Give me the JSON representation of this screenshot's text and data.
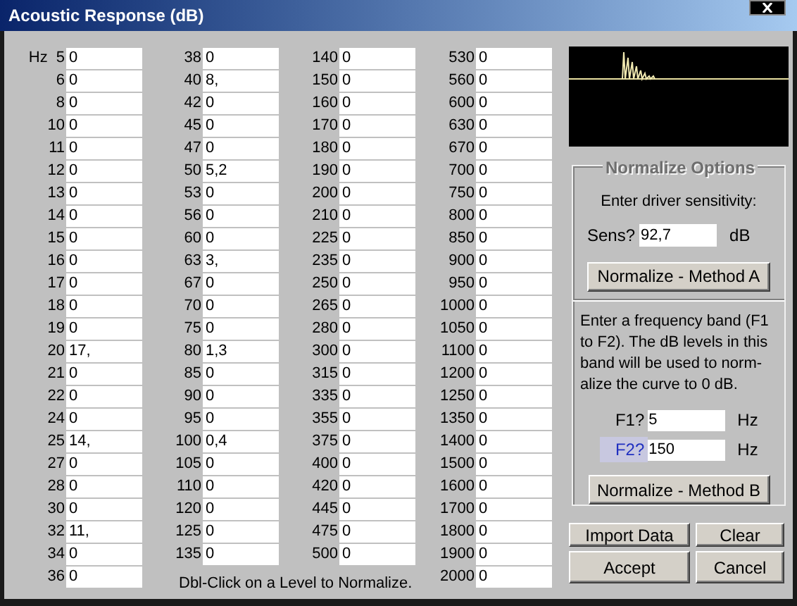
{
  "window": {
    "title": "Acoustic Response (dB)"
  },
  "unit_label": "Hz",
  "columns": [
    [
      {
        "hz": "5",
        "value": "0"
      },
      {
        "hz": "6",
        "value": "0"
      },
      {
        "hz": "8",
        "value": "0"
      },
      {
        "hz": "10",
        "value": "0"
      },
      {
        "hz": "11",
        "value": "0"
      },
      {
        "hz": "12",
        "value": "0"
      },
      {
        "hz": "13",
        "value": "0"
      },
      {
        "hz": "14",
        "value": "0"
      },
      {
        "hz": "15",
        "value": "0"
      },
      {
        "hz": "16",
        "value": "0"
      },
      {
        "hz": "17",
        "value": "0"
      },
      {
        "hz": "18",
        "value": "0"
      },
      {
        "hz": "19",
        "value": "0"
      },
      {
        "hz": "20",
        "value": "17,"
      },
      {
        "hz": "21",
        "value": "0"
      },
      {
        "hz": "22",
        "value": "0"
      },
      {
        "hz": "24",
        "value": "0"
      },
      {
        "hz": "25",
        "value": "14,"
      },
      {
        "hz": "27",
        "value": "0"
      },
      {
        "hz": "28",
        "value": "0"
      },
      {
        "hz": "30",
        "value": "0"
      },
      {
        "hz": "32",
        "value": "11,"
      },
      {
        "hz": "34",
        "value": "0"
      },
      {
        "hz": "36",
        "value": "0"
      }
    ],
    [
      {
        "hz": "38",
        "value": "0"
      },
      {
        "hz": "40",
        "value": "8,"
      },
      {
        "hz": "42",
        "value": "0"
      },
      {
        "hz": "45",
        "value": "0"
      },
      {
        "hz": "47",
        "value": "0"
      },
      {
        "hz": "50",
        "value": "5,2"
      },
      {
        "hz": "53",
        "value": "0"
      },
      {
        "hz": "56",
        "value": "0"
      },
      {
        "hz": "60",
        "value": "0"
      },
      {
        "hz": "63",
        "value": "3,"
      },
      {
        "hz": "67",
        "value": "0"
      },
      {
        "hz": "70",
        "value": "0"
      },
      {
        "hz": "75",
        "value": "0"
      },
      {
        "hz": "80",
        "value": "1,3"
      },
      {
        "hz": "85",
        "value": "0"
      },
      {
        "hz": "90",
        "value": "0"
      },
      {
        "hz": "95",
        "value": "0"
      },
      {
        "hz": "100",
        "value": "0,4"
      },
      {
        "hz": "105",
        "value": "0"
      },
      {
        "hz": "110",
        "value": "0"
      },
      {
        "hz": "120",
        "value": "0"
      },
      {
        "hz": "125",
        "value": "0"
      },
      {
        "hz": "135",
        "value": "0"
      }
    ],
    [
      {
        "hz": "140",
        "value": "0"
      },
      {
        "hz": "150",
        "value": "0"
      },
      {
        "hz": "160",
        "value": "0"
      },
      {
        "hz": "170",
        "value": "0"
      },
      {
        "hz": "180",
        "value": "0"
      },
      {
        "hz": "190",
        "value": "0"
      },
      {
        "hz": "200",
        "value": "0"
      },
      {
        "hz": "210",
        "value": "0"
      },
      {
        "hz": "225",
        "value": "0"
      },
      {
        "hz": "235",
        "value": "0"
      },
      {
        "hz": "250",
        "value": "0"
      },
      {
        "hz": "265",
        "value": "0"
      },
      {
        "hz": "280",
        "value": "0"
      },
      {
        "hz": "300",
        "value": "0"
      },
      {
        "hz": "315",
        "value": "0"
      },
      {
        "hz": "335",
        "value": "0"
      },
      {
        "hz": "355",
        "value": "0"
      },
      {
        "hz": "375",
        "value": "0"
      },
      {
        "hz": "400",
        "value": "0"
      },
      {
        "hz": "420",
        "value": "0"
      },
      {
        "hz": "445",
        "value": "0"
      },
      {
        "hz": "475",
        "value": "0"
      },
      {
        "hz": "500",
        "value": "0"
      }
    ],
    [
      {
        "hz": "530",
        "value": "0"
      },
      {
        "hz": "560",
        "value": "0"
      },
      {
        "hz": "600",
        "value": "0"
      },
      {
        "hz": "630",
        "value": "0"
      },
      {
        "hz": "670",
        "value": "0"
      },
      {
        "hz": "700",
        "value": "0"
      },
      {
        "hz": "750",
        "value": "0"
      },
      {
        "hz": "800",
        "value": "0"
      },
      {
        "hz": "850",
        "value": "0"
      },
      {
        "hz": "900",
        "value": "0"
      },
      {
        "hz": "950",
        "value": "0"
      },
      {
        "hz": "1000",
        "value": "0"
      },
      {
        "hz": "1050",
        "value": "0"
      },
      {
        "hz": "1100",
        "value": "0"
      },
      {
        "hz": "1200",
        "value": "0"
      },
      {
        "hz": "1250",
        "value": "0"
      },
      {
        "hz": "1350",
        "value": "0"
      },
      {
        "hz": "1400",
        "value": "0"
      },
      {
        "hz": "1500",
        "value": "0"
      },
      {
        "hz": "1600",
        "value": "0"
      },
      {
        "hz": "1700",
        "value": "0"
      },
      {
        "hz": "1800",
        "value": "0"
      },
      {
        "hz": "1900",
        "value": "0"
      },
      {
        "hz": "2000",
        "value": "0"
      }
    ]
  ],
  "hint": "Dbl-Click on a Level to Normalize.",
  "normalize_options": {
    "title": "Normalize Options",
    "method_a": {
      "prompt": "Enter driver sensitivity:",
      "field": {
        "label": "Sens?",
        "value": "92,7",
        "unit": "dB"
      },
      "button": "Normalize - Method A"
    },
    "method_b": {
      "prompt": "Enter a frequency band (F1 to F2). The dB levels in this band will be used to norm-alize the curve to 0 dB.",
      "fields": [
        {
          "label": "F1?",
          "value": "5",
          "unit": "Hz",
          "highlighted": false
        },
        {
          "label": "F2?",
          "value": "150",
          "unit": "Hz",
          "highlighted": true
        }
      ],
      "button": "Normalize - Method B"
    }
  },
  "buttons": [
    "Import Data",
    "Clear",
    "Accept",
    "Cancel"
  ]
}
